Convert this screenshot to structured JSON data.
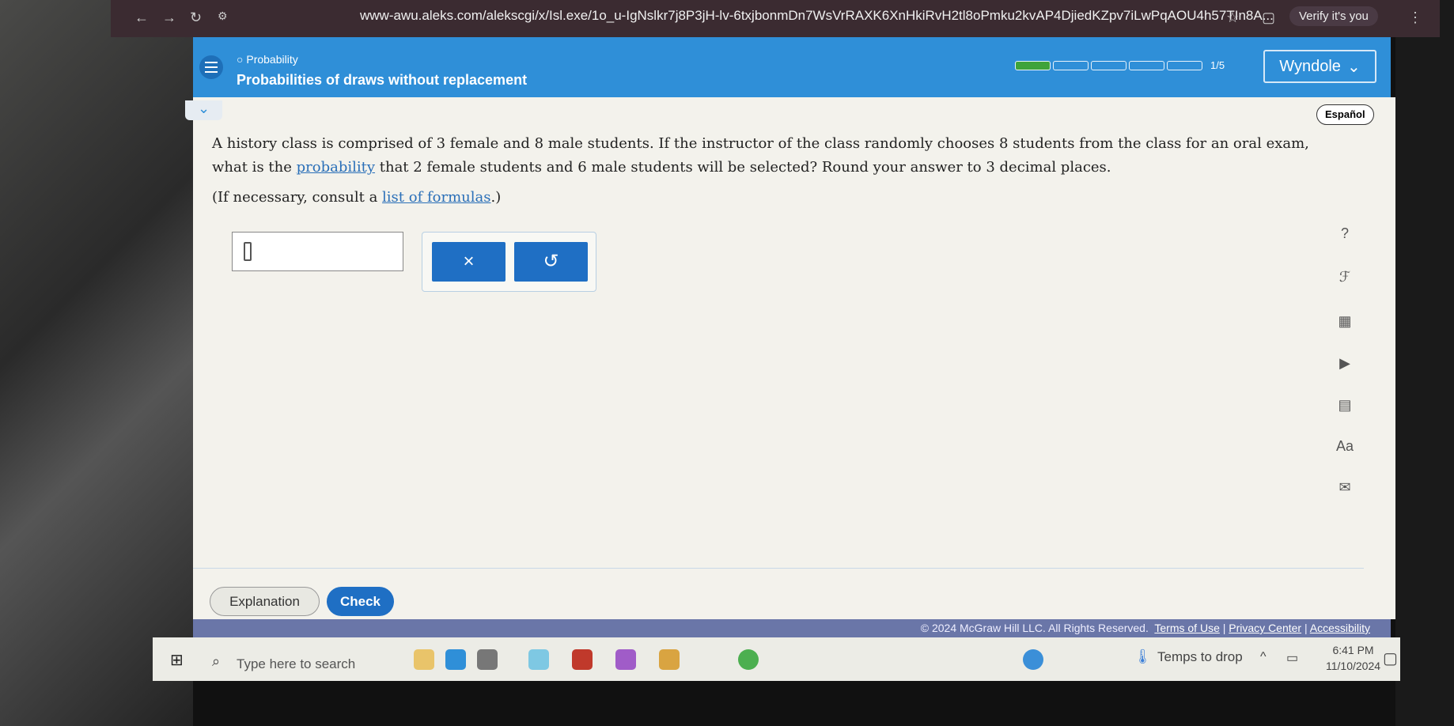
{
  "browser": {
    "url": "www-awu.aleks.com/alekscgi/x/Isl.exe/1o_u-IgNslkr7j8P3jH-lv-6txjbonmDn7WsVrRAXK6XnHkiRvH2tl8oPmku2kvAP4DjiedKZpv7iLwPqAOU4h57TIn8A...",
    "profile_label": "Verify it's you"
  },
  "header": {
    "topic": "Probability",
    "title": "Probabilities of draws without replacement",
    "progress": {
      "completed": 1,
      "total": 5,
      "label": "1/5"
    },
    "user": "Wyndole",
    "accent": "#2f8fd8"
  },
  "content": {
    "language_button": "Español",
    "question_part1": "A history class is comprised of 3 female and 8 male students. If the instructor of the class randomly chooses 8 students from the class for an oral exam, what is the ",
    "question_link": "probability",
    "question_part2": " that 2 female students and 6 male students will be selected? Round your answer to 3 decimal places.",
    "formulas_prefix": "(If necessary, consult a ",
    "formulas_link": "list of formulas",
    "formulas_suffix": ".)",
    "answer_value": "",
    "clear_label": "×",
    "undo_label": "↺",
    "explanation_label": "Explanation",
    "check_label": "Check"
  },
  "side_tools": [
    "help-icon",
    "formula-icon",
    "calculator-icon",
    "video-icon",
    "ebook-icon",
    "dictionary-icon",
    "message-icon"
  ],
  "footer": {
    "copyright": "© 2024 McGraw Hill LLC. All Rights Reserved.",
    "links": [
      "Terms of Use",
      "Privacy Center",
      "Accessibility"
    ]
  },
  "taskbar": {
    "search_placeholder": "Type here to search",
    "weather": "Temps to drop",
    "time": "6:41 PM",
    "date": "11/10/2024"
  }
}
